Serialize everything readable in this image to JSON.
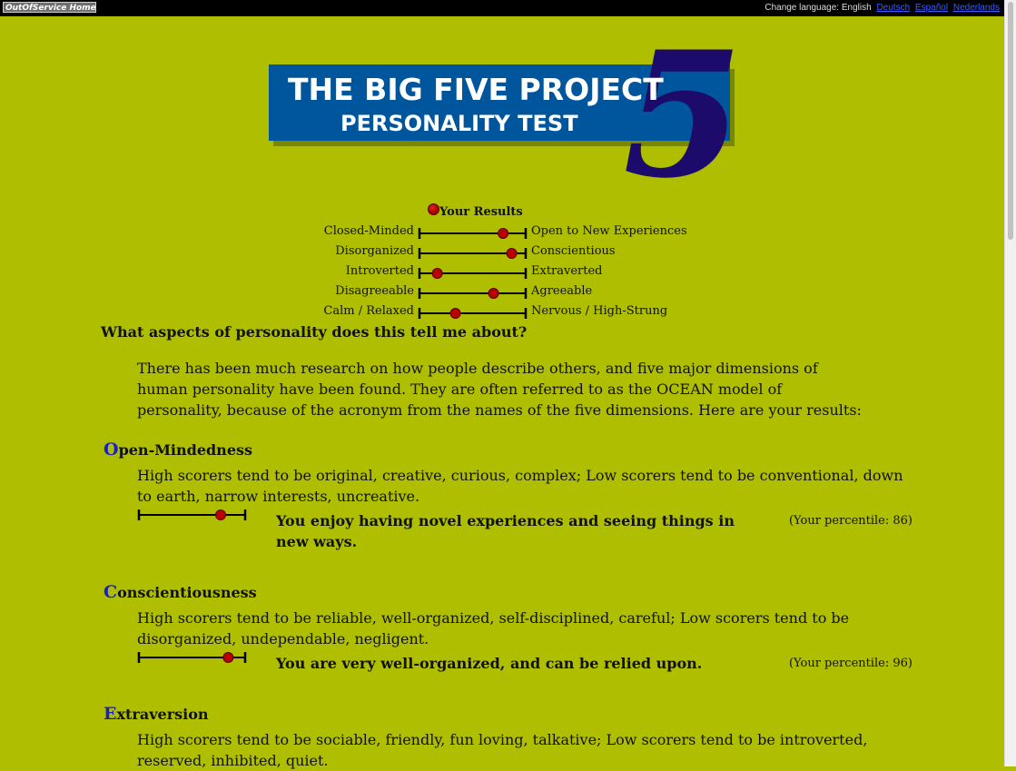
{
  "topbar": {
    "home_label": "OutOfService Home",
    "change_language_label": "Change language: English",
    "languages": [
      "Deutsch",
      "Español",
      "Nederlands"
    ]
  },
  "banner": {
    "line1": "THE BIG FIVE PROJECT",
    "line2": "PERSONALITY TEST",
    "digit": "5",
    "colors": {
      "box": "#00569c",
      "digit": "#1c0b6a",
      "text": "#ffffff"
    }
  },
  "results": {
    "title": "Your Results",
    "rows": [
      {
        "left": "Closed-Minded",
        "right": "Open to New Experiences",
        "level": 0.82
      },
      {
        "left": "Disorganized",
        "right": "Conscientious",
        "level": 0.91
      },
      {
        "left": "Introverted",
        "right": "Extraverted",
        "level": 0.13
      },
      {
        "left": "Disagreeable",
        "right": "Agreeable",
        "level": 0.72
      },
      {
        "left": "Calm / Relaxed",
        "right": "Nervous / High-Strung",
        "level": 0.32
      }
    ]
  },
  "question": "What aspects of personality does this tell me about?",
  "intro": "There has been much research on how people describe others, and five major dimensions of human personality have been found. They are often referred to as the OCEAN model of personality, because of the acronym from the names of the five dimensions. Here are your results:",
  "dimensions": [
    {
      "cap": "O",
      "rest": "pen-Mindedness",
      "desc": "High scorers tend to be original, creative, curious, complex; Low scorers tend to be conventional, down to earth, narrow interests, uncreative.",
      "result": "You enjoy having novel experiences and seeing things in new ways.",
      "percentile_text": "(Your percentile: 86)",
      "percentile": 86,
      "level": 0.8
    },
    {
      "cap": "C",
      "rest": "onscientiousness",
      "desc": "High scorers tend to be reliable, well-organized, self-disciplined, careful; Low scorers tend to be disorganized, undependable, negligent.",
      "result": "You are very well-organized, and can be relied upon.",
      "percentile_text": "(Your percentile: 96)",
      "percentile": 96,
      "level": 0.88
    },
    {
      "cap": "E",
      "rest": "xtraversion",
      "desc": "High scorers tend to be sociable, friendly, fun loving, talkative; Low scorers tend to be introverted, reserved, inhibited, quiet."
    }
  ]
}
